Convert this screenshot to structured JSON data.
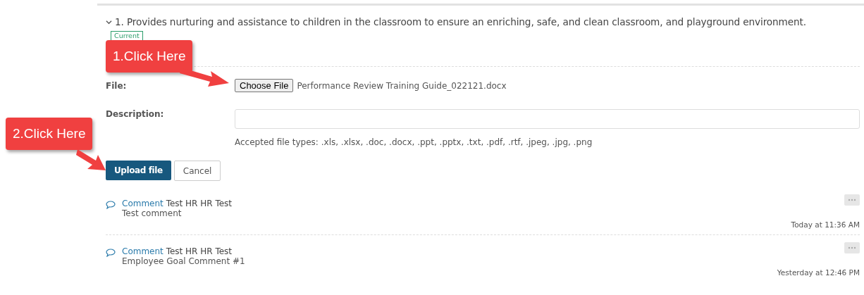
{
  "goal": {
    "expanded": true,
    "title": "1. Provides nurturing and assistance to children in the classroom to ensure an enriching, safe, and clean classroom, and playground environment.",
    "status": "Current"
  },
  "form": {
    "file_label": "File:",
    "choose_button": "Choose File",
    "file_name": "Performance Review Training Guide_022121.docx",
    "description_label": "Description:",
    "accepted_types": "Accepted file types: .xls, .xlsx, .doc, .docx, .ppt, .pptx, .txt, .pdf, .rtf, .jpeg, .jpg, .png",
    "upload_button": "Upload file",
    "cancel_button": "Cancel"
  },
  "comments": [
    {
      "type_label": "Comment",
      "author": "Test HR HR Test",
      "text": "Test comment",
      "time": "Today at 11:36 AM"
    },
    {
      "type_label": "Comment",
      "author": "Test HR HR Test",
      "text": "Employee Goal Comment #1",
      "time": "Yesterday at 12:46 PM"
    }
  ],
  "callouts": [
    {
      "text": "1.Click Here"
    },
    {
      "text": "2.Click Here"
    }
  ]
}
